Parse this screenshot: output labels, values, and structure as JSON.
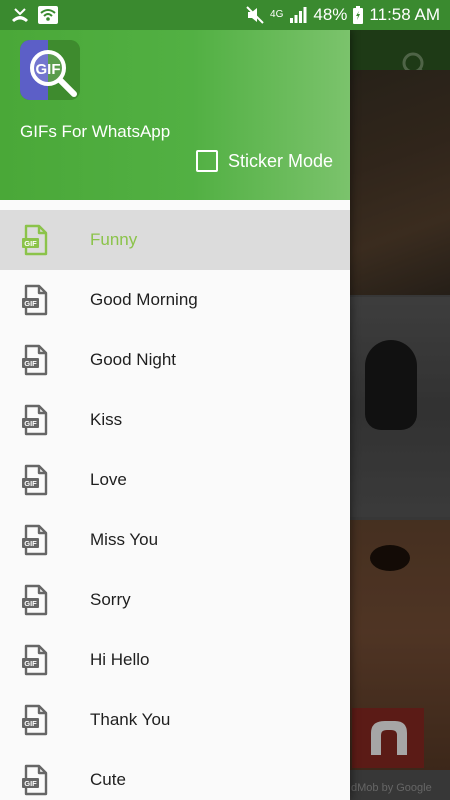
{
  "status_bar": {
    "battery": "48%",
    "time": "11:58 AM",
    "network": "4G"
  },
  "drawer": {
    "app_name": "GIFs For WhatsApp",
    "logo_text": "GIF",
    "sticker_mode_label": "Sticker Mode",
    "sticker_mode_checked": false,
    "items": [
      {
        "label": "Funny",
        "active": true
      },
      {
        "label": "Good Morning"
      },
      {
        "label": "Good Night"
      },
      {
        "label": "Kiss"
      },
      {
        "label": "Love"
      },
      {
        "label": "Miss You"
      },
      {
        "label": "Sorry"
      },
      {
        "label": "Hi Hello"
      },
      {
        "label": "Thank You"
      },
      {
        "label": "Cute"
      }
    ],
    "icon_name": "gif-file-icon"
  },
  "background": {
    "ad_text": "dMob by Google"
  },
  "colors": {
    "status_bar": "#3a8a2f",
    "header_green": "#52b043",
    "active_item": "#8bc34a",
    "active_bg": "#dcdcdc"
  }
}
